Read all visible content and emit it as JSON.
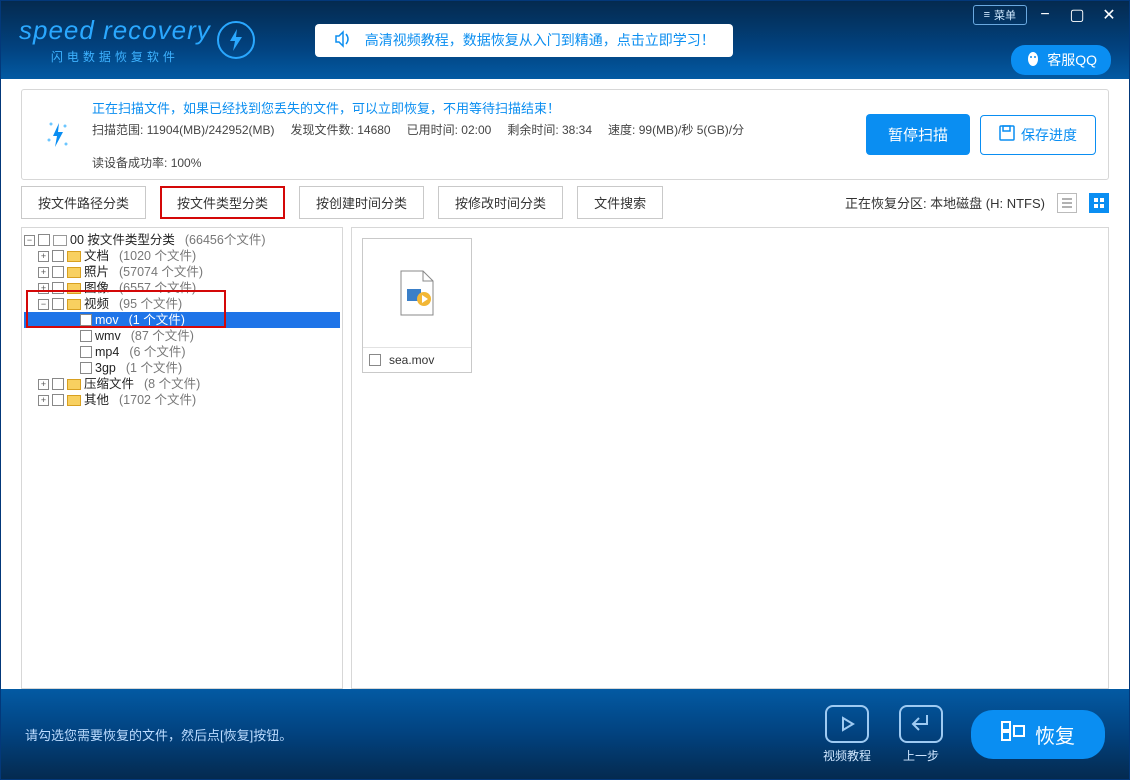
{
  "titlebar": {
    "menu_label": "菜单"
  },
  "header": {
    "brand": "speed recovery",
    "brand_sub": "闪电数据恢复软件",
    "tip": "高清视频教程，数据恢复从入门到精通，点击立即学习！",
    "kefu": "客服QQ"
  },
  "status": {
    "msg": "正在扫描文件，如果已经找到您丢失的文件，可以立即恢复，不用等待扫描结束！",
    "scan_range_label": "扫描范围:",
    "scan_range_value": "11904(MB)/242952(MB)",
    "found_label": "发现文件数:",
    "found_value": "14680",
    "elapsed_label": "已用时间:",
    "elapsed_value": "02:00",
    "remain_label": "剩余时间:",
    "remain_value": "38:34",
    "speed_label": "速度:",
    "speed_value": "99(MB)/秒  5(GB)/分",
    "read_label": "读设备成功率:",
    "read_value": "100%",
    "pause": "暂停扫描",
    "save": "保存进度"
  },
  "tabs": {
    "t1": "按文件路径分类",
    "t2": "按文件类型分类",
    "t3": "按创建时间分类",
    "t4": "按修改时间分类",
    "t5": "文件搜索",
    "partition_label": "正在恢复分区: 本地磁盘 (H: NTFS)"
  },
  "tree": {
    "root_label": "00 按文件类型分类",
    "root_count": "(66456个文件)",
    "doc_label": "文档",
    "doc_count": "(1020 个文件)",
    "photo_label": "照片",
    "photo_count": "(57074 个文件)",
    "image_label": "图像",
    "image_count": "(6557 个文件)",
    "video_label": "视频",
    "video_count": "(95 个文件)",
    "mov_label": "mov",
    "mov_count": "(1 个文件)",
    "wmv_label": "wmv",
    "wmv_count": "(87 个文件)",
    "mp4_label": "mp4",
    "mp4_count": "(6 个文件)",
    "gp_label": "3gp",
    "gp_count": "(1 个文件)",
    "zip_label": "压缩文件",
    "zip_count": "(8 个文件)",
    "other_label": "其他",
    "other_count": "(1702 个文件)"
  },
  "file": {
    "name": "sea.mov"
  },
  "footer": {
    "hint": "请勾选您需要恢复的文件，然后点[恢复]按钮。",
    "tutorial": "视频教程",
    "prev": "上一步",
    "recover": "恢复"
  }
}
